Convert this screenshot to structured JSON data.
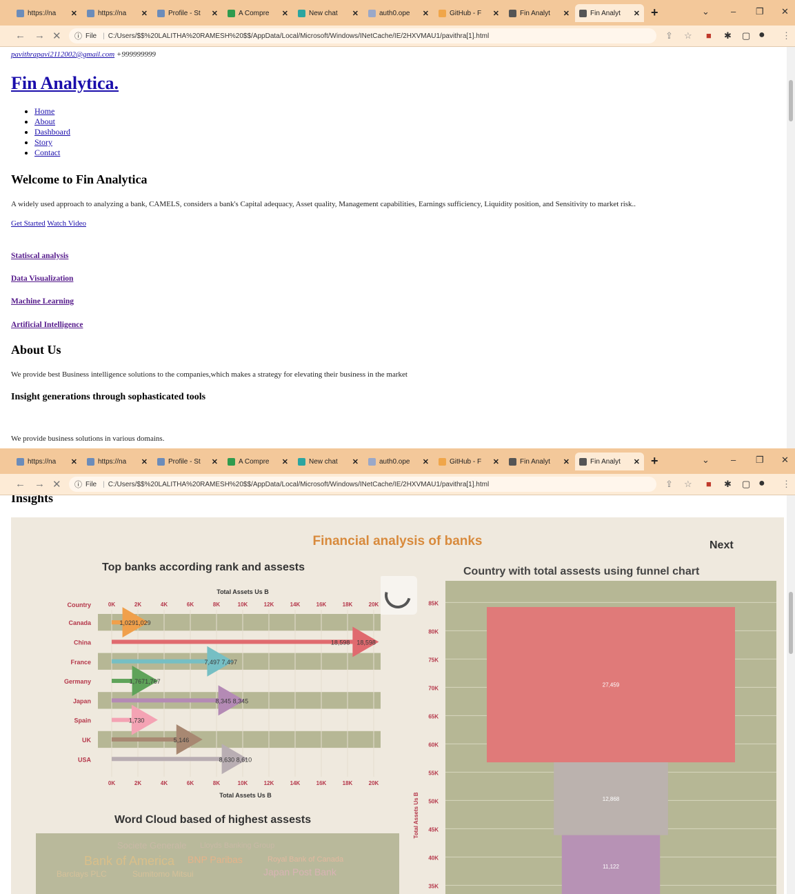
{
  "browser": {
    "tabs": [
      {
        "label": "https://na",
        "color": "#6b8cba"
      },
      {
        "label": "https://na",
        "color": "#6b8cba"
      },
      {
        "label": "Profile - St",
        "color": "#6b8cba"
      },
      {
        "label": "A Compre",
        "color": "#2f9b4e"
      },
      {
        "label": "New chat",
        "color": "#2ba5a0"
      },
      {
        "label": "auth0.ope",
        "color": "#9aa8c8"
      },
      {
        "label": "GitHub - F",
        "color": "#f0a64a"
      },
      {
        "label": "Fin Analyt",
        "color": "#555555"
      },
      {
        "label": "Fin Analyt",
        "color": "#555555",
        "active": true
      }
    ],
    "url": "C:/Users/$$%20LALITHA%20RAMESH%20$$/AppData/Local/Microsoft/Windows/INetCache/IE/2HXVMAU1/pavithra[1].html",
    "url_prefix": "File",
    "close_glyph": "✕"
  },
  "header": {
    "email": "pavithrapavi2112002@gmail.com",
    "phone": "+999999999",
    "site_title": "Fin Analytica."
  },
  "nav": [
    "Home",
    "About",
    "Dashboard",
    "Story",
    "Contact"
  ],
  "hero": {
    "heading": "Welcome to Fin Analytica",
    "description": "A widely used approach to analyzing a bank, CAMELS, considers a bank's Capital adequacy, Asset quality, Management capabilities, Earnings sufficiency, Liquidity position, and Sensitivity to market risk..",
    "get_started": "Get Started",
    "watch_video": "Watch Video"
  },
  "services": [
    "Statiscal analysis",
    "Data Visualization",
    "Machine Learning",
    "Artificial Intelligence"
  ],
  "about": {
    "heading": "About Us",
    "text": "We provide best Business intelligence solutions to the companies,which makes a strategy for elevating their business in the market",
    "subheading": "Insight generations through sophasticated tools",
    "domains_text": "We provide business solutions in various domains."
  },
  "insights": {
    "heading": "Insights",
    "dashboard_title": "Financial analysis of banks",
    "next_label": "Next",
    "left_chart_title": "Top banks according rank and assests",
    "right_chart_title": "Country with total assests using funnel chart",
    "wordcloud_title": "Word Cloud based of highest assests",
    "wordcloud_words": [
      {
        "text": "Societe Generale",
        "color": "#c9b9a6",
        "size": 13
      },
      {
        "text": "Lloyds Banking Group",
        "color": "#c9b9a6",
        "size": 11
      },
      {
        "text": "Bank of America",
        "color": "#d9bf8a",
        "size": 18
      },
      {
        "text": "BNP Paribas",
        "color": "#e5b48a",
        "size": 14
      },
      {
        "text": "Royal Bank of Canada",
        "color": "#e3b9a0",
        "size": 11
      },
      {
        "text": "Barclays PLC",
        "color": "#d6c19a",
        "size": 12
      },
      {
        "text": "Sumitomo Mitsui",
        "color": "#d6c19a",
        "size": 12
      },
      {
        "text": "Japan Post Bank",
        "color": "#d8b4b4",
        "size": 14
      }
    ]
  },
  "chart_data": [
    {
      "type": "bar",
      "title": "",
      "xlabel": "Total Assets Us B",
      "ylabel": "Country",
      "categories": [
        "Canada",
        "China",
        "France",
        "Germany",
        "Japan",
        "Spain",
        "UK",
        "USA"
      ],
      "values": [
        1029,
        18598,
        7497,
        1767,
        8345,
        1730,
        5146,
        8610
      ],
      "labels": [
        "1,0291,029",
        "18,598",
        "7,497 7,497",
        "1,7671,767",
        "8,345 8,345",
        "1,730",
        "5,146",
        "8,630 8,610"
      ],
      "second_labels": [
        "",
        "18,598",
        "",
        "",
        "",
        "",
        "",
        ""
      ],
      "colors": [
        "#f0a04b",
        "#e06a6f",
        "#76bfc4",
        "#5fa35a",
        "#b48ab5",
        "#f4a3b4",
        "#a88872",
        "#b9aeb3"
      ],
      "xticks": [
        "0K",
        "2K",
        "4K",
        "6K",
        "8K",
        "10K",
        "12K",
        "14K",
        "16K",
        "18K",
        "20K"
      ],
      "xlim": [
        0,
        20000
      ]
    },
    {
      "type": "bar",
      "title": "",
      "ylabel": "Total Assets Us B",
      "yticks": [
        "85K",
        "80K",
        "75K",
        "70K",
        "65K",
        "60K",
        "55K",
        "50K",
        "45K",
        "40K",
        "35K"
      ],
      "ylim": [
        35000,
        85000
      ],
      "segments": [
        {
          "label": "27,459",
          "value": 27459,
          "color": "#e07a79"
        },
        {
          "label": "12,868",
          "value": 12868,
          "color": "#bbb2ae"
        },
        {
          "label": "11,122",
          "value": 11122,
          "color": "#b792b5"
        }
      ]
    }
  ]
}
